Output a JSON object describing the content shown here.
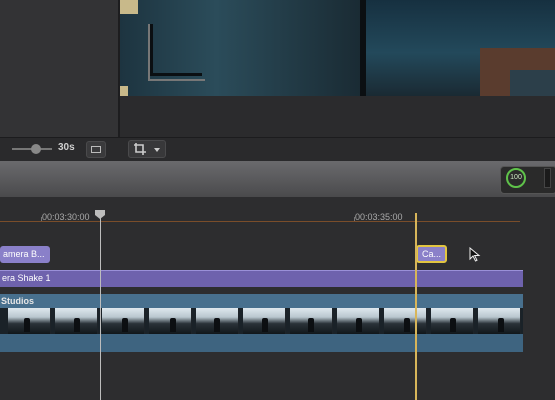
{
  "browser": {
    "zoom_duration": "30s",
    "icons": [
      "zoom-slider-icon",
      "filmstrip-icon"
    ]
  },
  "viewer": {
    "crop_menu_icon": "crop-icon",
    "dropdown_icon": "chevron-down-icon"
  },
  "toolbar": {
    "background_tasks_progress": "100",
    "accent_color": "#5fc24a"
  },
  "timeline": {
    "timecodes": [
      "00:03:30:00",
      "00:03:35:00"
    ],
    "clips": {
      "upper_left": "amera B...",
      "upper_selected": "Ca...",
      "adjustment": "era Shake 1",
      "main_storyline": "Studios"
    },
    "colors": {
      "clip": "#8a80c9",
      "selection": "#e2c541",
      "storyline": "#48708e",
      "ruler": "#7a4d2a"
    }
  }
}
